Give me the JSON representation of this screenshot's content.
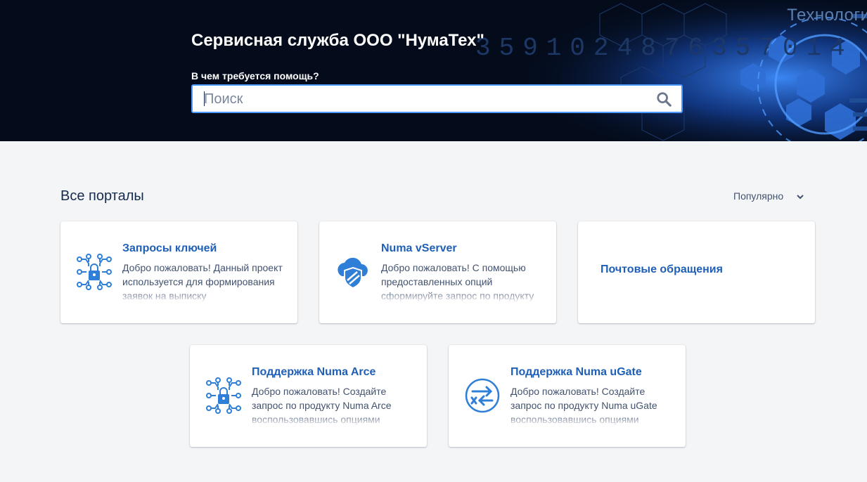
{
  "banner": {
    "decor_text": "Технологии б",
    "decor_digits": "3591024876357014",
    "title": "Сервисная служба ООО \"НумаТех\"",
    "help_label": "В чем требуется помощь?",
    "search_placeholder": "Поиск"
  },
  "main": {
    "section_title": "Все порталы",
    "sort_label": "Популярно"
  },
  "cards": [
    {
      "title": "Запросы ключей",
      "description": "Добро пожаловать! Данный проект используется для формирования заявок на выписку",
      "icon": "circuit-lock-icon"
    },
    {
      "title": "Numa vServer",
      "description": "Добро пожаловать! С помощью предоставленных опций сформируйте запрос по продукту",
      "icon": "cloud-shield-icon"
    },
    {
      "title": "Почтовые обращения",
      "description": "",
      "icon": ""
    },
    {
      "title": "Поддержка Numa Arce",
      "description": "Добро пожаловать! Создайте запрос по продукту Numa Arce воспользовавшись опциями",
      "icon": "circuit-lock-icon"
    },
    {
      "title": "Поддержка Numa uGate",
      "description": "Добро пожаловать! Создайте запрос по продукту Numa uGate воспользовавшись опциями",
      "icon": "exchange-arrows-icon"
    }
  ],
  "colors": {
    "banner_bg": "#040c1c",
    "link": "#1f5fb6",
    "icon_blue": "#2f7fd8",
    "focus": "#4c9aff"
  }
}
